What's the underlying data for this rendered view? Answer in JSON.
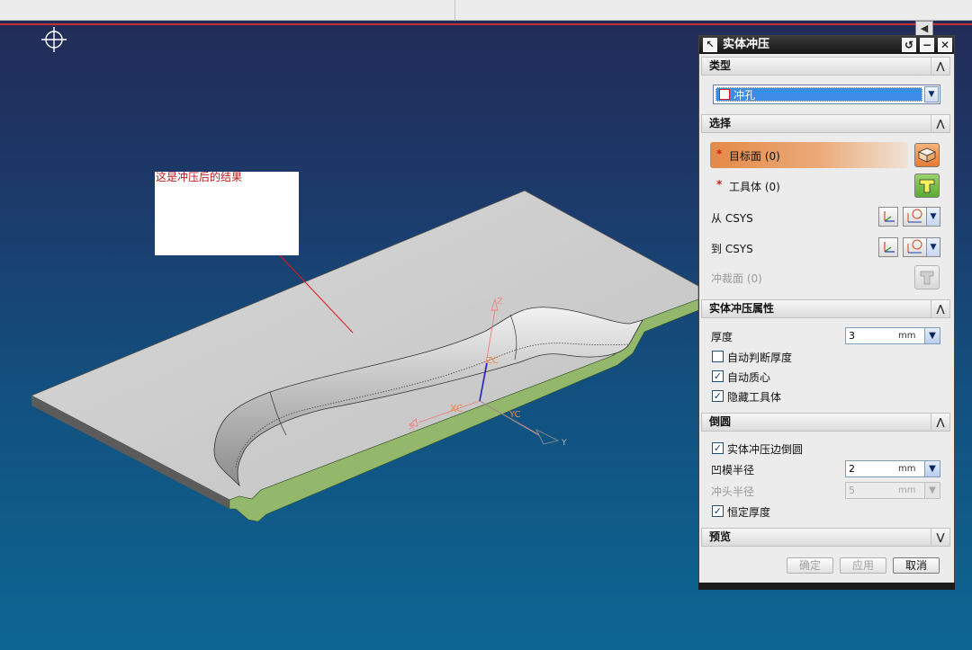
{
  "viewport": {
    "note_text": "这是冲压后的结果",
    "axis_labels": {
      "z": "Z",
      "y": "Y",
      "x": "X",
      "xc": "XC",
      "yc": "YC",
      "zc": "ZC"
    }
  },
  "dialog": {
    "title": "实体冲压",
    "controls": {
      "reset": "↺",
      "minimize": "−",
      "close": "✕"
    },
    "sections": {
      "type": {
        "label": "类型",
        "chevron": "⋀"
      },
      "select": {
        "label": "选择",
        "chevron": "⋀"
      },
      "props": {
        "label": "实体冲压属性",
        "chevron": "⋀"
      },
      "fillet": {
        "label": "倒圆",
        "chevron": "⋀"
      },
      "preview": {
        "label": "预览",
        "chevron": "⋁"
      }
    },
    "type_value": "冲孔",
    "select_rows": {
      "target_face": {
        "star": "*",
        "label": "目标面 (0)"
      },
      "tool_body": {
        "star": "*",
        "label": "工具体 (0)"
      },
      "from_csys": "从 CSYS",
      "to_csys": "到 CSYS",
      "punch_face": "冲裁面 (0)"
    },
    "thickness": {
      "label": "厚度",
      "value": "3",
      "unit": "mm"
    },
    "checkboxes": {
      "auto_thickness": {
        "label": "自动判断厚度",
        "checked": false
      },
      "auto_centroid": {
        "label": "自动质心",
        "checked": true
      },
      "hide_tool": {
        "label": "隐藏工具体",
        "checked": true
      },
      "edge_fillet": {
        "label": "实体冲压边倒圆",
        "checked": true
      },
      "constant_thickness": {
        "label": "恒定厚度",
        "checked": true
      }
    },
    "die_radius": {
      "label": "凹模半径",
      "value": "2",
      "unit": "mm"
    },
    "punch_radius": {
      "label": "冲头半径",
      "value": "5",
      "unit": "mm"
    },
    "buttons": {
      "ok": "确定",
      "apply": "应用",
      "cancel": "取消"
    }
  },
  "colors": {
    "target_highlight": "#e48a47",
    "plate_top": "#cfcfcf",
    "plate_edge": "#93b86b",
    "note_text": "#c21b1b"
  }
}
